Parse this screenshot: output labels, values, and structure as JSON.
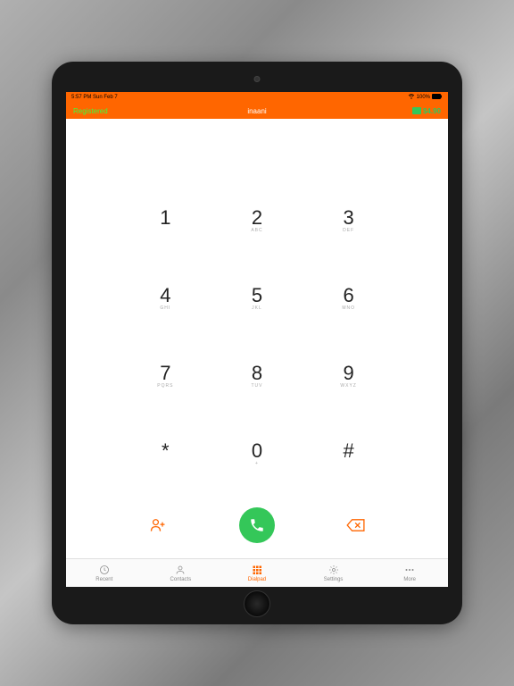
{
  "status": {
    "time": "5:57 PM",
    "date": "Sun Feb 7",
    "battery": "100%"
  },
  "header": {
    "registered": "Registered",
    "title": "inaani",
    "balance": "$4.90"
  },
  "keypad": [
    {
      "digit": "1",
      "letters": ""
    },
    {
      "digit": "2",
      "letters": "ABC"
    },
    {
      "digit": "3",
      "letters": "DEF"
    },
    {
      "digit": "4",
      "letters": "GHI"
    },
    {
      "digit": "5",
      "letters": "JKL"
    },
    {
      "digit": "6",
      "letters": "MNO"
    },
    {
      "digit": "7",
      "letters": "PQRS"
    },
    {
      "digit": "8",
      "letters": "TUV"
    },
    {
      "digit": "9",
      "letters": "WXYZ"
    },
    {
      "digit": "*",
      "letters": ""
    },
    {
      "digit": "0",
      "letters": "+"
    },
    {
      "digit": "#",
      "letters": ""
    }
  ],
  "tabs": [
    {
      "label": "Recent"
    },
    {
      "label": "Contacts"
    },
    {
      "label": "Dialpad"
    },
    {
      "label": "Settings"
    },
    {
      "label": "More"
    }
  ]
}
